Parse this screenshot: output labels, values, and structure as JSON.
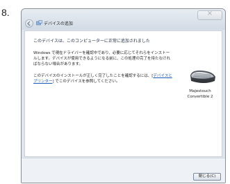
{
  "step": {
    "number": "8."
  },
  "window": {
    "title": "デバイスの追加",
    "close_label": "×"
  },
  "content": {
    "heading": "このデバイスは、このコンピューターに正常に追加されました",
    "paragraph1": "Windows で現在ドライバーを確認中であり、必要に応じてそれらをインストールします。デバイスが使用できるようになる前に、この処理の完了を待たなければならない場合があります。",
    "paragraph2_prefix": "このデバイスのインストールが正しく完了したことを確認するには、[",
    "paragraph2_link": "デバイスとプリンター",
    "paragraph2_suffix": "] でこのデバイスを参照してください。"
  },
  "device": {
    "icon": "mouse-device-icon",
    "name_line1": "Majestouch",
    "name_line2": "Convertible 2"
  },
  "footer": {
    "close_button_label": "閉じる(C)"
  }
}
